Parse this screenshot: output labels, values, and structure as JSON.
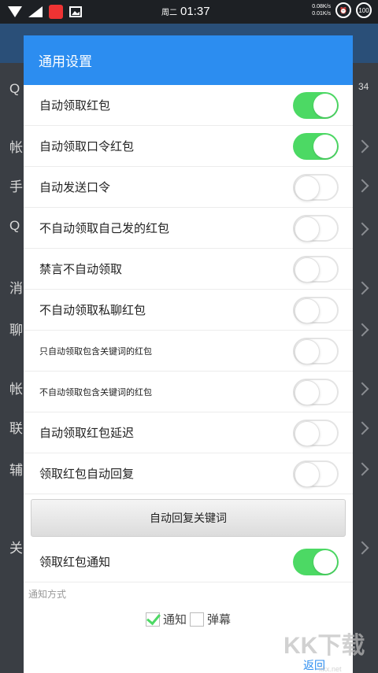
{
  "status_bar": {
    "day": "周二",
    "time": "01:37",
    "net_up": "0.08K/s",
    "net_down": "0.01K/s",
    "battery": "100"
  },
  "background": {
    "chars": [
      "Q",
      "帐",
      "手",
      "Q",
      "消",
      "聊",
      "帐",
      "联",
      "辅",
      "关"
    ],
    "right_text": "34"
  },
  "dialog": {
    "title": "通用设置",
    "toggles": [
      {
        "label": "自动领取红包",
        "on": true
      },
      {
        "label": "自动领取口令红包",
        "on": true
      },
      {
        "label": "自动发送口令",
        "on": false
      },
      {
        "label": "不自动领取自己发的红包",
        "on": false
      },
      {
        "label": "禁言不自动领取",
        "on": false
      },
      {
        "label": "不自动领取私聊红包",
        "on": false
      },
      {
        "label": "只自动领取包含关键词的红包",
        "on": false,
        "small": true
      },
      {
        "label": "不自动领取包含关键词的红包",
        "on": false,
        "small": true
      },
      {
        "label": "自动领取红包延迟",
        "on": false
      },
      {
        "label": "领取红包自动回复",
        "on": false
      }
    ],
    "keyword_button": "自动回复关键词",
    "notify_toggle": {
      "label": "领取红包通知",
      "on": true
    },
    "notify_method_label": "通知方式",
    "option_notify": {
      "label": "通知",
      "checked": true
    },
    "option_popup": {
      "label": "弹幕",
      "checked": false
    },
    "return_label": "返回"
  },
  "watermark": {
    "text": "KK下载",
    "sub": "kkx.net"
  },
  "colors": {
    "accent": "#2c8df0",
    "toggle_on": "#4cd964"
  }
}
